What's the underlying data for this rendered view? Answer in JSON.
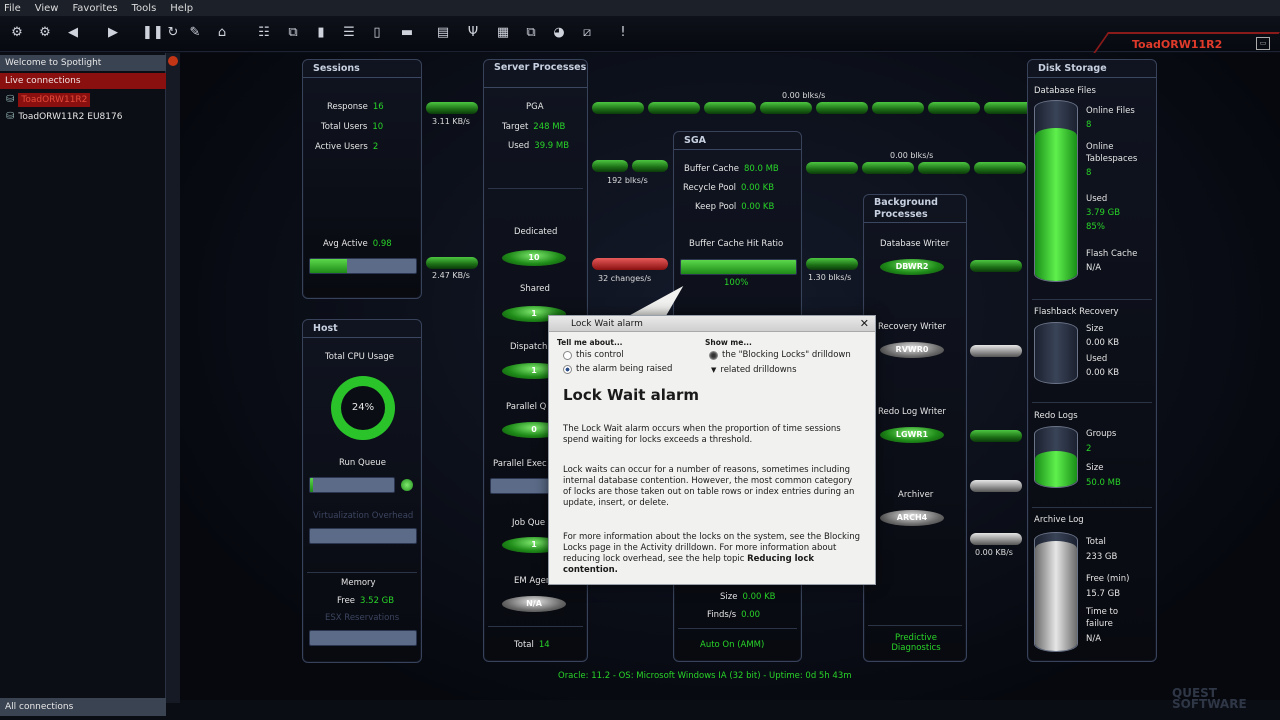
{
  "menu": [
    "File",
    "View",
    "Favorites",
    "Tools",
    "Help"
  ],
  "connection_title": "ToadORW11R2",
  "sidebar": {
    "welcome": "Welcome to Spotlight",
    "live": "Live connections",
    "items": [
      "ToadORW11R2",
      "ToadORW11R2 EU8176"
    ],
    "all": "All connections"
  },
  "sessions": {
    "title": "Sessions",
    "response": "Response",
    "response_v": "16",
    "total_users": "Total Users",
    "total_users_v": "10",
    "active_users": "Active Users",
    "active_users_v": "2",
    "avg_active": "Avg Active",
    "avg_active_v": "0.98",
    "avg_fill": 0.35
  },
  "host": {
    "title": "Host",
    "cpu": "Total CPU Usage",
    "cpu_v": "24%",
    "run_queue": "Run Queue",
    "virt": "Virtualization Overhead",
    "memory": "Memory",
    "free": "Free",
    "free_v": "3.52 GB",
    "esx": "ESX Reservations"
  },
  "server": {
    "title": "Server Processes",
    "pga": "PGA",
    "target": "Target",
    "target_v": "248 MB",
    "used": "Used",
    "used_v": "39.9 MB",
    "dedicated": "Dedicated",
    "dedicated_v": "10",
    "shared": "Shared",
    "shared_v": "1",
    "dispatch": "Dispatch",
    "dispatch_v": "1",
    "parallel_q": "Parallel Q",
    "parallel_q_v": "0",
    "parallel_exec": "Parallel Exec",
    "job_que": "Job Que",
    "job_que_v": "1",
    "em_agent": "EM Agent",
    "em_agent_v": "N/A",
    "total": "Total",
    "total_v": "14"
  },
  "sga": {
    "title": "SGA",
    "buffer_cache": "Buffer Cache",
    "buffer_cache_v": "80.0 MB",
    "recycle_pool": "Recycle Pool",
    "recycle_pool_v": "0.00 KB",
    "keep_pool": "Keep Pool",
    "keep_pool_v": "0.00 KB",
    "hit_ratio": "Buffer Cache Hit Ratio",
    "hit_ratio_v": "100%",
    "size": "Size",
    "size_v": "0.00 KB",
    "finds": "Finds/s",
    "finds_v": "0.00",
    "auto": "Auto On (AMM)"
  },
  "background": {
    "title": "Background Processes",
    "db_writer": "Database Writer",
    "db_writer_v": "DBWR2",
    "recovery_writer": "Recovery Writer",
    "recovery_writer_v": "RVWR0",
    "redo_writer": "Redo Log Writer",
    "redo_writer_v": "LGWR1",
    "archiver": "Archiver",
    "archiver_v": "ARCH4",
    "predictive": "Predictive Diagnostics"
  },
  "disk": {
    "title": "Disk Storage",
    "db_files": "Database Files",
    "online_files": "Online Files",
    "online_files_v": "8",
    "online_ts": "Online Tablespaces",
    "online_ts_v": "8",
    "used": "Used",
    "used_v": "3.79 GB",
    "used_pct": "85%",
    "flash_cache": "Flash Cache",
    "flash_cache_v": "N/A",
    "flashback": "Flashback Recovery",
    "fb_size": "Size",
    "fb_size_v": "0.00 KB",
    "fb_used": "Used",
    "fb_used_v": "0.00 KB",
    "redo": "Redo Logs",
    "groups": "Groups",
    "groups_v": "2",
    "redo_size": "Size",
    "redo_size_v": "50.0 MB",
    "archive": "Archive Log",
    "arch_total": "Total",
    "arch_total_v": "233 GB",
    "arch_free": "Free (min)",
    "arch_free_v": "15.7 GB",
    "ttf": "Time to failure",
    "ttf_v": "N/A",
    "used_fill": 0.85,
    "redo_fill": 0.6,
    "archive_fill": 0.93
  },
  "flows": {
    "f1": "0.00 blks/s",
    "f2": "3.11 KB/s",
    "f3": "192 blks/s",
    "f4": "0.00 blks/s",
    "f5": "2.47 KB/s",
    "f6": "32 changes/s",
    "f7": "1.30 blks/s",
    "f8": "0.00 KB/s"
  },
  "status": "Oracle: 11.2 - OS: Microsoft Windows IA (32 bit) - Uptime: 0d 5h 43m",
  "popup": {
    "head": "Lock Wait alarm",
    "tell": "Tell me about...",
    "show": "Show me...",
    "this_control": "this control",
    "alarm_raised": "the alarm being raised",
    "blocking": "the \"Blocking Locks\" drilldown",
    "related": "related drilldowns",
    "title": "Lock Wait alarm",
    "p1": "The Lock Wait alarm occurs when the proportion of time sessions spend waiting for locks exceeds a threshold.",
    "p2": "Lock waits can occur for a number of reasons, sometimes including internal database contention. However, the most common category of locks are those taken out on table rows or index entries during an update, insert, or delete.",
    "p3a": "For more information about the locks on the system, see the Blocking Locks page in the Activity drilldown. For more information about reducing lock overhead, see the help topic ",
    "p3b": "Reducing lock contention."
  },
  "logo": "QUEST SOFTWARE"
}
